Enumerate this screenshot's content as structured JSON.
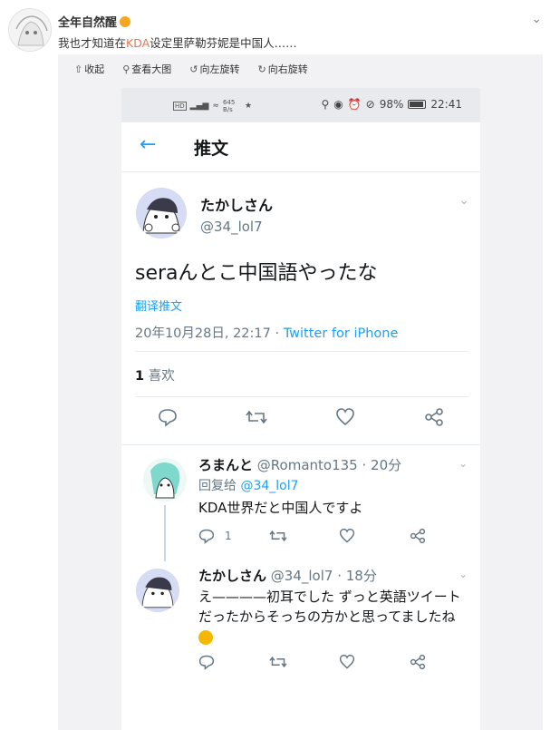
{
  "post": {
    "author": "全年自然醒",
    "text_before": "我也才知道在",
    "text_highlight": "KDA",
    "text_after": "设定里萨勒芬妮是中国人……"
  },
  "viewer_toolbar": {
    "collapse": "收起",
    "view_large": "查看大图",
    "rotate_left": "向左旋转",
    "rotate_right": "向右旋转"
  },
  "status_bar": {
    "net_speed": "645 B/s",
    "battery": "98%",
    "time": "22:41"
  },
  "twitter": {
    "header_title": "推文",
    "main_tweet": {
      "name": "たかしさん",
      "handle": "@34_lol7",
      "text": "seraんとこ中国語やったな",
      "translate": "翻译推文",
      "timestamp": "20年10月28日, 22:17",
      "separator": " · ",
      "source": "Twitter for iPhone",
      "likes_count": "1",
      "likes_label": "喜欢"
    },
    "reply1": {
      "name": "ろまんと",
      "handle_time": "@Romanto135 · 20分",
      "reply_to_label": "回复给",
      "reply_to_handle": "@34_lol7",
      "text": "KDA世界だと中国人ですよ",
      "reply_count": "1"
    },
    "reply2": {
      "name": "たかしさん",
      "handle_time": "@34_lol7 · 18分",
      "text": "え————初耳でした ずっと英語ツイートだったからそっちの方かと思ってましたね"
    }
  },
  "colors": {
    "twitter_blue": "#1da1f2",
    "weibo_highlight": "#eb7350"
  }
}
